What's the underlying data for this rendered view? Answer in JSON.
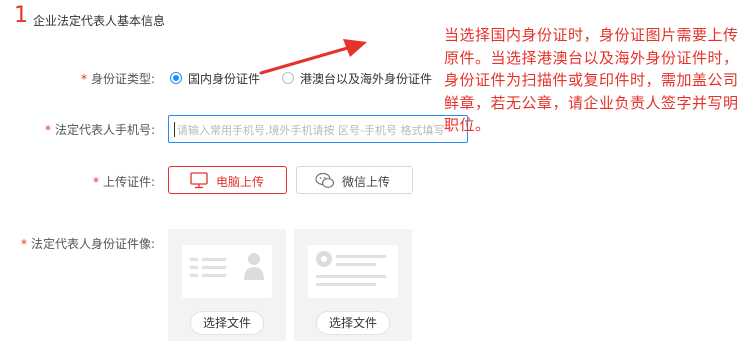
{
  "section": {
    "number": "1",
    "title": "企业法定代表人基本信息"
  },
  "id_type": {
    "label": "身份证类型:",
    "required_mark": "*",
    "options": [
      {
        "label": "国内身份证件",
        "checked": true
      },
      {
        "label": "港澳台以及海外身份证件",
        "checked": false
      }
    ]
  },
  "phone": {
    "label": "法定代表人手机号:",
    "required_mark": "*",
    "placeholder": "请输入常用手机号,境外手机请按 区号-手机号 格式填写"
  },
  "upload": {
    "label": "上传证件:",
    "required_mark": "*",
    "pc_upload_label": "电脑上传",
    "wechat_upload_label": "微信上传"
  },
  "id_images": {
    "label": "法定代表人身份证件像:",
    "required_mark": "*",
    "cards": [
      {
        "button_label": "选择文件",
        "side": "front-icon"
      },
      {
        "button_label": "选择文件",
        "side": "back-icon"
      }
    ]
  },
  "annotation": {
    "text": "当选择国内身份证时，身份证图片需要上传原件。当选择港澳台以及海外身份证件时，身份证件为扫描件或复印件时，需加盖公司鲜章，若无公章，请企业负责人签字并写明职位。",
    "color": "#e6322a"
  },
  "colors": {
    "accent": "#e6322a",
    "focus": "#1f8cff"
  }
}
